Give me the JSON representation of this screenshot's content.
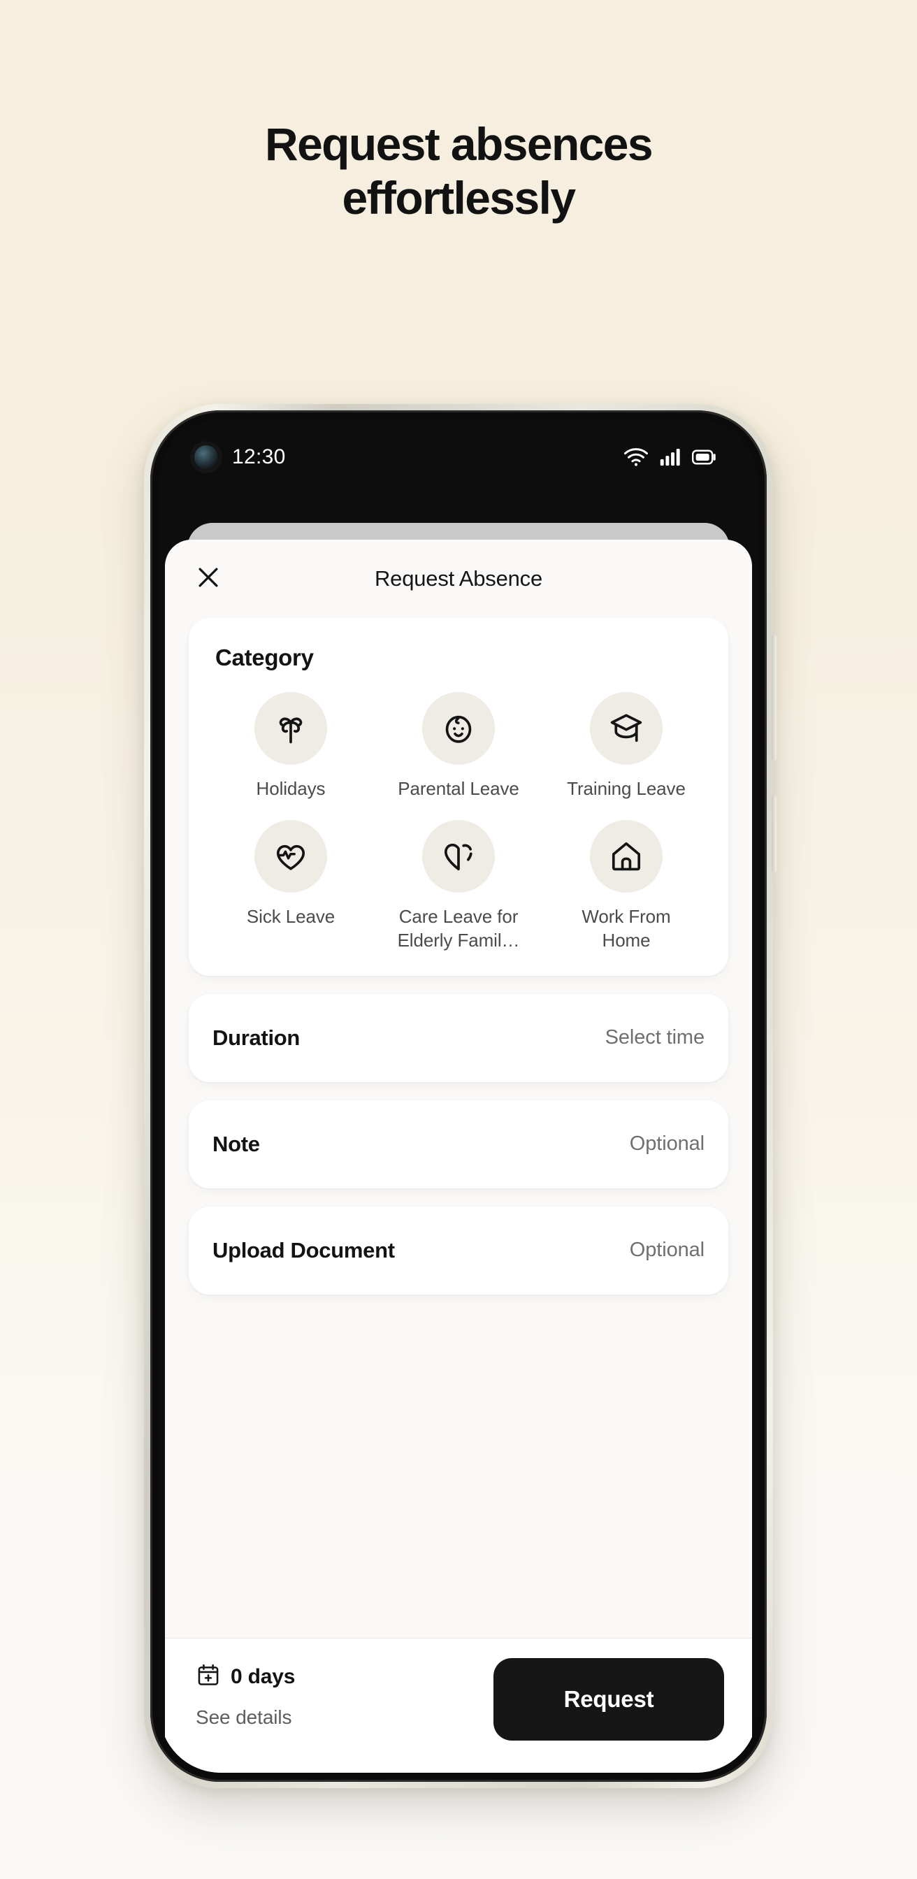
{
  "hero": {
    "headline_line1": "Request absences",
    "headline_line2": "effortlessly"
  },
  "colors": {
    "page_background": "#F6EFDF",
    "sheet_background": "#FAF9F7",
    "card_background": "#FFFFFF",
    "icon_circle": "#EEECE4",
    "primary_button": "#161616",
    "text_primary": "#131313",
    "text_secondary": "#6F6F6F"
  },
  "status_bar": {
    "time": "12:30",
    "icons": [
      "camera-punch-hole",
      "wifi-icon",
      "cellular-signal-icon",
      "battery-icon"
    ]
  },
  "modal": {
    "title": "Request Absence",
    "close_icon": "close-icon",
    "category": {
      "section_title": "Category",
      "items": [
        {
          "label": "Holidays",
          "icon": "palm-tree-icon"
        },
        {
          "label": "Parental Leave",
          "icon": "baby-face-icon"
        },
        {
          "label": "Training Leave",
          "icon": "graduation-cap-icon"
        },
        {
          "label": "Sick Leave",
          "icon": "heart-pulse-icon"
        },
        {
          "label": "Care Leave for Elderly Famil…",
          "icon": "half-heart-icon"
        },
        {
          "label": "Work From Home",
          "icon": "home-icon"
        }
      ]
    },
    "rows": [
      {
        "label": "Duration",
        "value": "Select time"
      },
      {
        "label": "Note",
        "value": "Optional"
      },
      {
        "label": "Upload Document",
        "value": "Optional"
      }
    ],
    "footer": {
      "days_icon": "calendar-plus-icon",
      "days_text": "0 days",
      "see_details_label": "See details",
      "request_button_label": "Request"
    }
  }
}
